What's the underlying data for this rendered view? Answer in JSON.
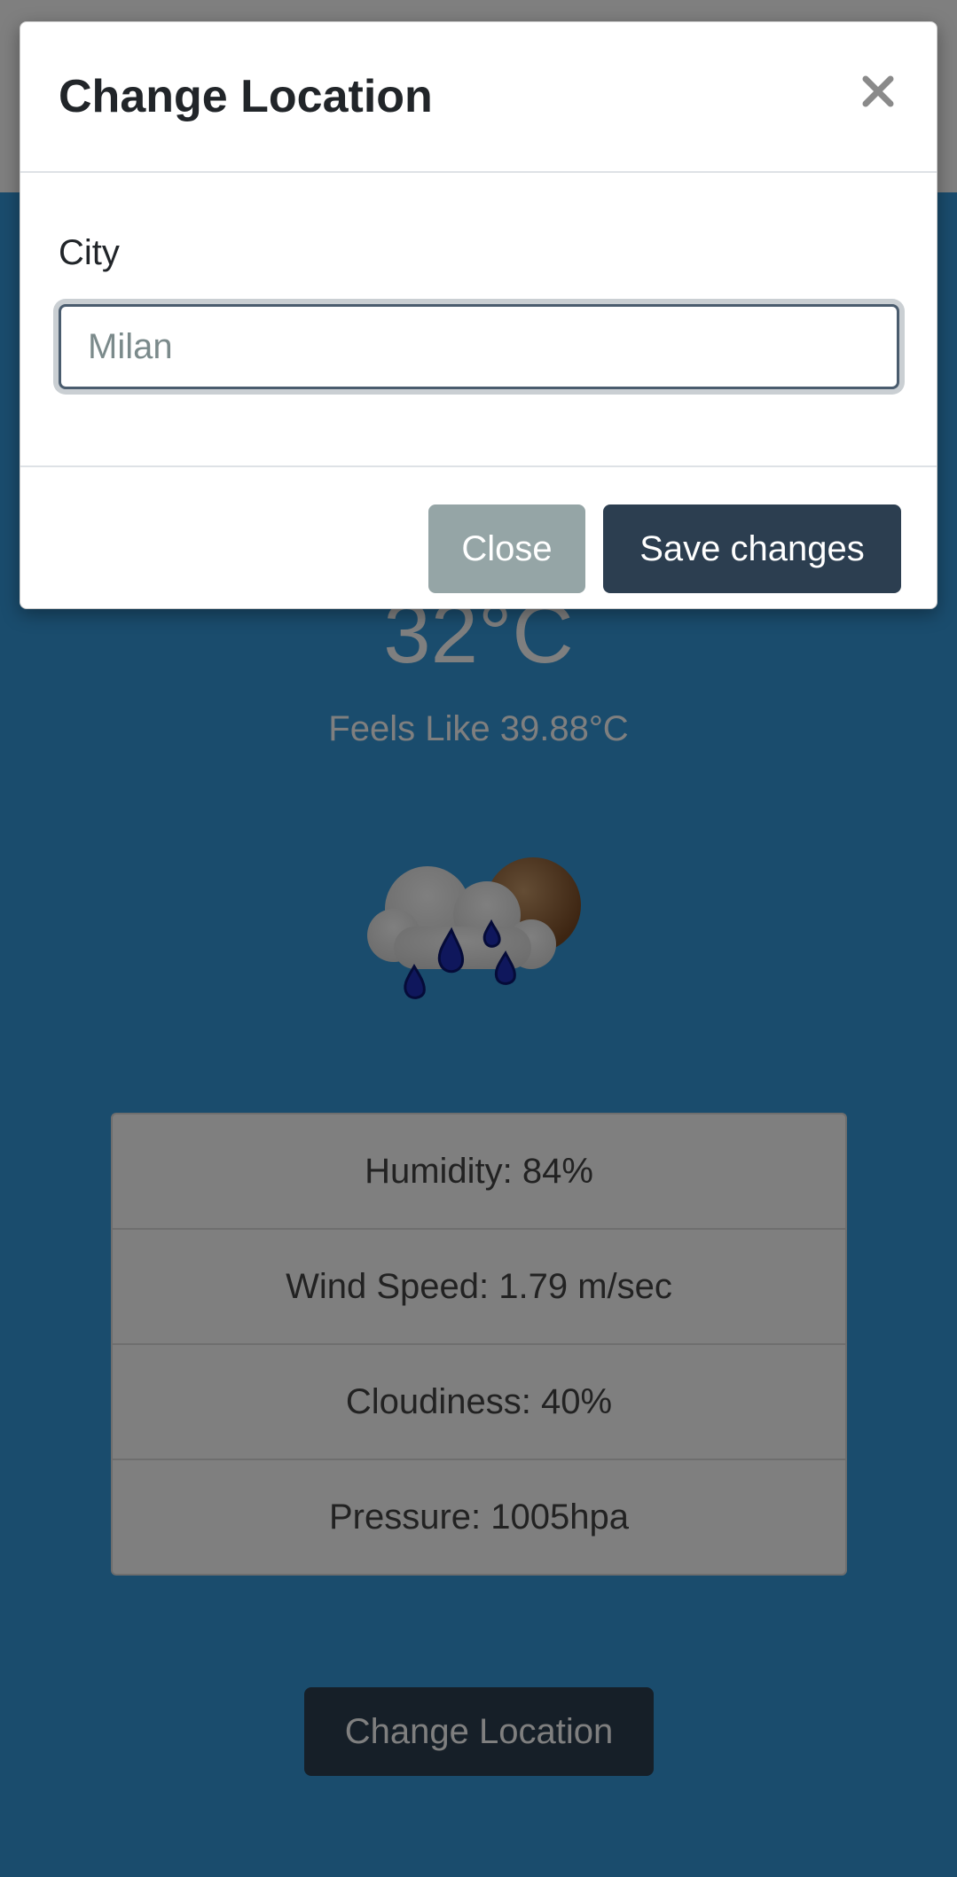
{
  "modal": {
    "title": "Change Location",
    "close_symbol": "×",
    "city_label": "City",
    "city_placeholder": "Milan",
    "city_value": "",
    "close_button": "Close",
    "save_button": "Save changes"
  },
  "weather": {
    "temperature": "32°C",
    "feels_like": "Feels Like 39.88°C",
    "icon": "rain-cloud-moon-icon",
    "stats": [
      {
        "label": "Humidity: 84%"
      },
      {
        "label": "Wind Speed: 1.79 m/sec"
      },
      {
        "label": "Cloudiness: 40%"
      },
      {
        "label": "Pressure: 1005hpa"
      }
    ],
    "change_location_button": "Change Location"
  },
  "colors": {
    "page_background": "#3498db",
    "primary": "#2c3e50",
    "secondary": "#95a5a6",
    "backdrop": "rgba(0,0,0,0.5)"
  }
}
